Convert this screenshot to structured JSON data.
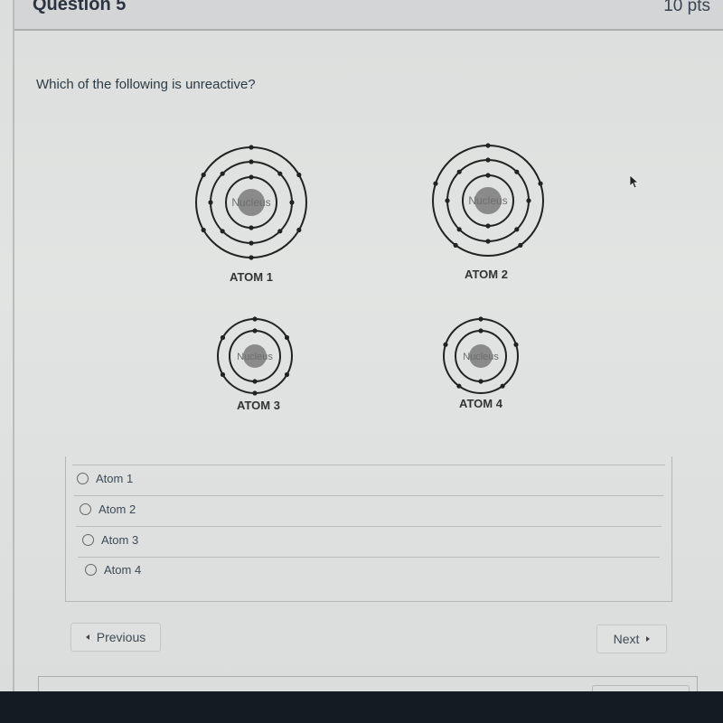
{
  "header": {
    "title": "Question 5",
    "points": "10 pts"
  },
  "question": {
    "text": "Which of the following is unreactive?"
  },
  "atoms": [
    {
      "label": "ATOM 1",
      "nucleus_label": "Nucleus",
      "shells": [
        2,
        8,
        6
      ]
    },
    {
      "label": "ATOM 2",
      "nucleus_label": "Nucleus",
      "shells": [
        2,
        8,
        5
      ]
    },
    {
      "label": "ATOM 3",
      "nucleus_label": "Nucleus",
      "shells": [
        2,
        6
      ]
    },
    {
      "label": "ATOM 4",
      "nucleus_label": "Nucleus",
      "shells": [
        2,
        5
      ]
    }
  ],
  "answers": [
    {
      "label": "Atom 1",
      "selected": false
    },
    {
      "label": "Atom 2",
      "selected": false
    },
    {
      "label": "Atom 3",
      "selected": false
    },
    {
      "label": "Atom 4",
      "selected": false
    }
  ],
  "navigation": {
    "previous_label": "Previous",
    "next_label": "Next"
  }
}
